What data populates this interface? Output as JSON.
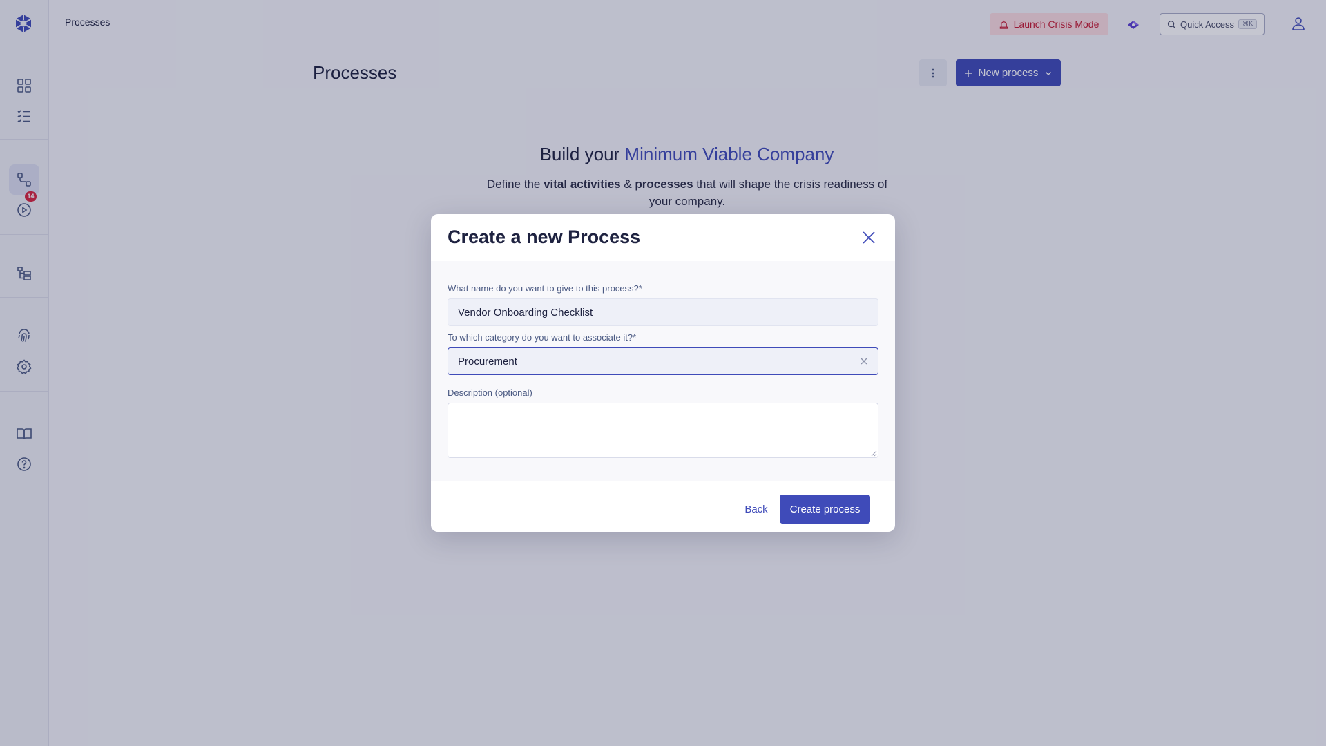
{
  "app": {
    "breadcrumb": "Processes",
    "accent_color": "#3f4bb9",
    "danger_color": "#c51a32"
  },
  "sidebar": {
    "items": [
      {
        "name": "dashboard",
        "icon": "grid-icon"
      },
      {
        "name": "tasks",
        "icon": "checklist-icon"
      },
      {
        "name": "processes",
        "icon": "workflow-icon",
        "active": true
      },
      {
        "name": "runs",
        "icon": "play-circle-icon",
        "badge": "14"
      },
      {
        "name": "organization",
        "icon": "hierarchy-icon"
      },
      {
        "name": "security",
        "icon": "fingerprint-icon"
      },
      {
        "name": "settings",
        "icon": "gear-icon"
      },
      {
        "name": "docs",
        "icon": "book-icon"
      },
      {
        "name": "help",
        "icon": "help-icon"
      }
    ]
  },
  "topbar": {
    "crisis_label": "Launch Crisis Mode",
    "quick_access_label": "Quick Access",
    "quick_access_shortcut": "⌘K"
  },
  "header": {
    "title": "Processes",
    "new_process_label": "New process"
  },
  "empty_state": {
    "heading_prefix": "Build your ",
    "heading_accent": "Minimum Viable Company",
    "sub_1": "Define the ",
    "sub_bold_1": "vital activities",
    "sub_2": " & ",
    "sub_bold_2": "processes",
    "sub_3": " that will shape the crisis readiness of your company."
  },
  "modal": {
    "title": "Create a new Process",
    "name_label": "What name do you want to give to this process?*",
    "name_value": "Vendor Onboarding Checklist",
    "category_label": "To which category do you want to associate it?*",
    "category_value": "Procurement",
    "description_label": "Description (optional)",
    "description_value": "",
    "back_label": "Back",
    "create_label": "Create process"
  }
}
